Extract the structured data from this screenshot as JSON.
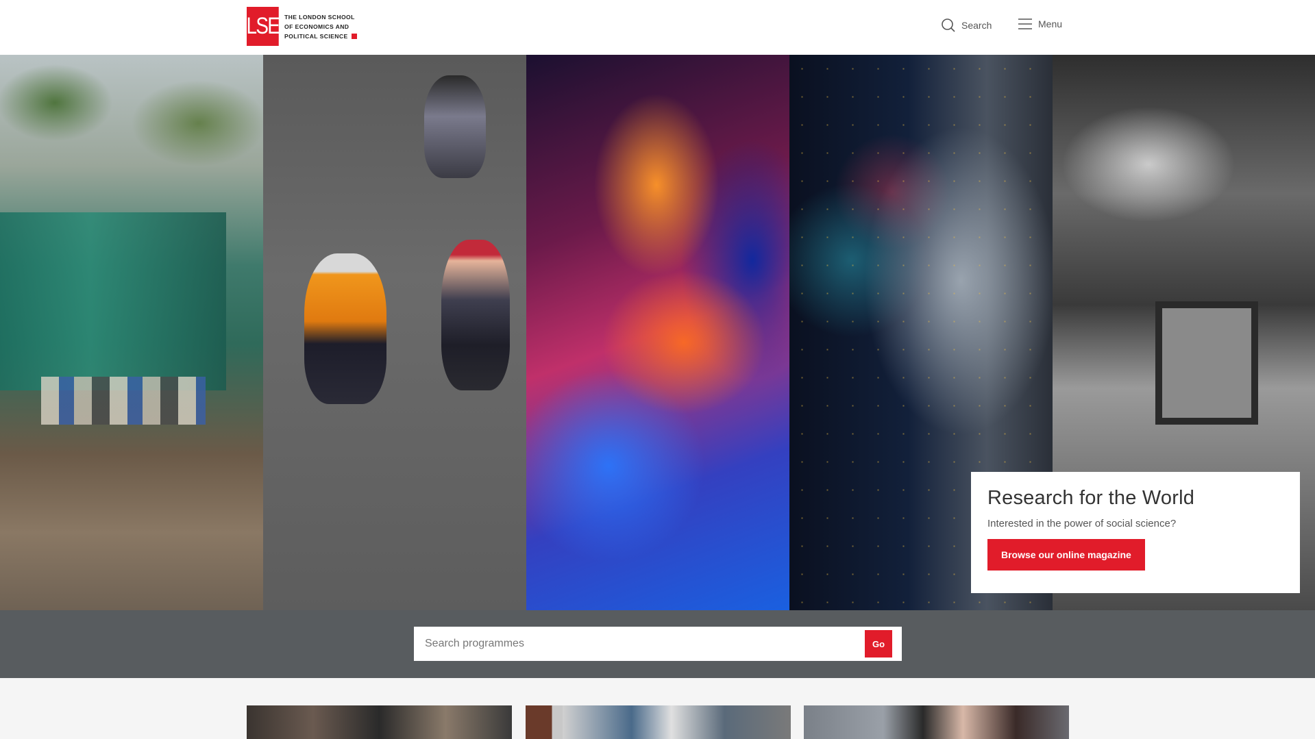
{
  "header": {
    "logo_mark": "LSE",
    "logo_lines": [
      "The London School",
      "of Economics and",
      "Political Science"
    ],
    "search_label": "Search",
    "menu_label": "Menu",
    "icons": {
      "search": "search-icon",
      "menu": "hamburger-menu-icon"
    }
  },
  "hero": {
    "panels": [
      "hero-image-storm-damaged-house",
      "hero-image-cyclists",
      "hero-image-dancer",
      "hero-image-face-network",
      "hero-image-historic-crowd"
    ],
    "card": {
      "title": "Research for the World",
      "subtitle": "Interested in the power of social science?",
      "button_label": "Browse our online magazine"
    }
  },
  "programme_search": {
    "placeholder": "Search programmes",
    "value": "",
    "go_label": "Go"
  },
  "colors": {
    "brand_red": "#e11c2a",
    "band_grey": "#585c5f",
    "page_bg": "#f5f5f5"
  }
}
